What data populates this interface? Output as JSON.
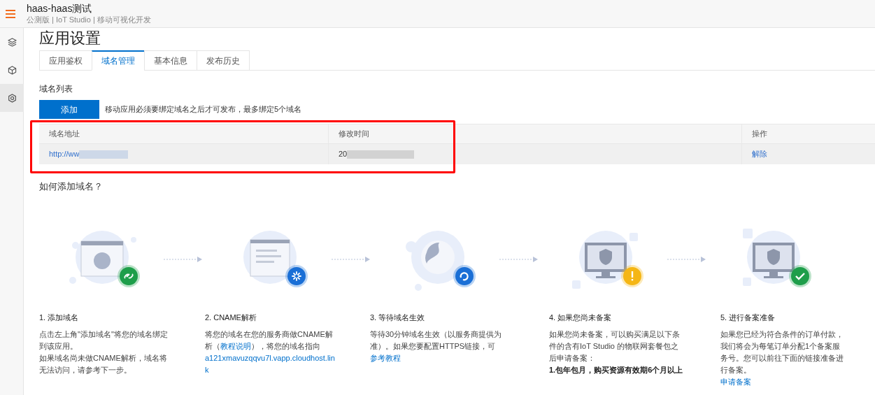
{
  "header": {
    "title": "haas-haas测试",
    "subtitle": "公测版 | IoT Studio | 移动可视化开发"
  },
  "sidebar": {
    "items": [
      {
        "kind": "layers",
        "selected": false
      },
      {
        "kind": "cube",
        "selected": false
      },
      {
        "kind": "settings",
        "selected": true
      }
    ]
  },
  "page_title": "应用设置",
  "tabs": [
    {
      "label": "应用鉴权",
      "selected": false
    },
    {
      "label": "域名管理",
      "selected": true
    },
    {
      "label": "基本信息",
      "selected": false
    },
    {
      "label": "发布历史",
      "selected": false
    }
  ],
  "section_title": "域名列表",
  "add_button": "添加",
  "hint": "移动应用必须要绑定域名之后才可发布，最多绑定5个域名",
  "table": {
    "columns": [
      "域名地址",
      "修改时间",
      "操作"
    ],
    "rows": [
      {
        "domain": "http://ww",
        "modified": "20",
        "action": "解除"
      }
    ]
  },
  "help_title": "如何添加域名？",
  "steps": [
    {
      "kind": "link",
      "title": "1. 添加域名",
      "paragraphs": [
        [
          {
            "kind": "text",
            "text": "点击左上角\"添加域名\"将您的域名绑定到该应用。"
          }
        ],
        [
          {
            "kind": "text",
            "text": "如果域名尚未做CNAME解析，域名将无法访问，请参考下一步。"
          }
        ]
      ]
    },
    {
      "kind": "spinner",
      "title": "2. CNAME解析",
      "paragraphs": [
        [
          {
            "kind": "text",
            "text": "将您的域名在您的服务商做CNAME解析（"
          },
          {
            "kind": "link",
            "text": "教程说明"
          },
          {
            "kind": "text",
            "text": "），将您的域名指向"
          },
          {
            "kind": "url",
            "text": "a121xmavuzqqvu7l.vapp.cloudhost.link"
          }
        ]
      ]
    },
    {
      "kind": "refresh",
      "title": "3. 等待域名生效",
      "paragraphs": [
        [
          {
            "kind": "text",
            "text": "等待30分钟域名生效（以服务商提供为准）。如果您要配置HTTPS链接，可"
          }
        ],
        [
          {
            "kind": "link",
            "text": "参考教程"
          }
        ]
      ]
    },
    {
      "kind": "warning",
      "title": "4. 如果您尚未备案",
      "paragraphs": [
        [
          {
            "kind": "text",
            "text": "如果您尚未备案，可以购买满足以下条件的含有IoT Studio 的物联网套餐包之后申请备案："
          }
        ],
        [
          {
            "kind": "bold",
            "text": "1.包年包月，购买资源有效期6个月以上"
          }
        ]
      ]
    },
    {
      "kind": "check",
      "title": "5. 进行备案准备",
      "paragraphs": [
        [
          {
            "kind": "text",
            "text": "如果您已经为符合条件的订单付款，我们将会为每笔订单分配1个备案服务号。您可以前往下面的链接准备进行备案。"
          }
        ],
        [
          {
            "kind": "link",
            "text": "申请备案"
          }
        ]
      ]
    }
  ]
}
